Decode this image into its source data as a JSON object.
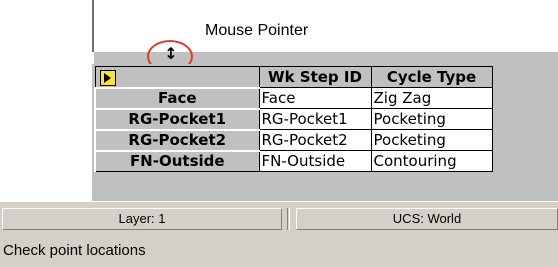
{
  "annotation": {
    "label": "Mouse Pointer"
  },
  "cursor": {
    "glyph": "↕"
  },
  "table": {
    "columns": [
      "Wk Step ID",
      "Cycle Type"
    ],
    "rows": [
      {
        "name": "Face",
        "step_id": "Face",
        "cycle_type": "Zig Zag"
      },
      {
        "name": "RG-Pocket1",
        "step_id": "RG-Pocket1",
        "cycle_type": "Pocketing"
      },
      {
        "name": "RG-Pocket2",
        "step_id": "RG-Pocket2",
        "cycle_type": "Pocketing"
      },
      {
        "name": "FN-Outside",
        "step_id": "FN-Outside",
        "cycle_type": "Contouring"
      }
    ]
  },
  "statusbar": {
    "layer": "Layer: 1",
    "ucs": "UCS: World"
  },
  "message": "Check point locations",
  "colors": {
    "annotation_circle": "#e03a2c",
    "corner_marker": "#f7e63a",
    "grid_gray": "#c0c0c0"
  }
}
